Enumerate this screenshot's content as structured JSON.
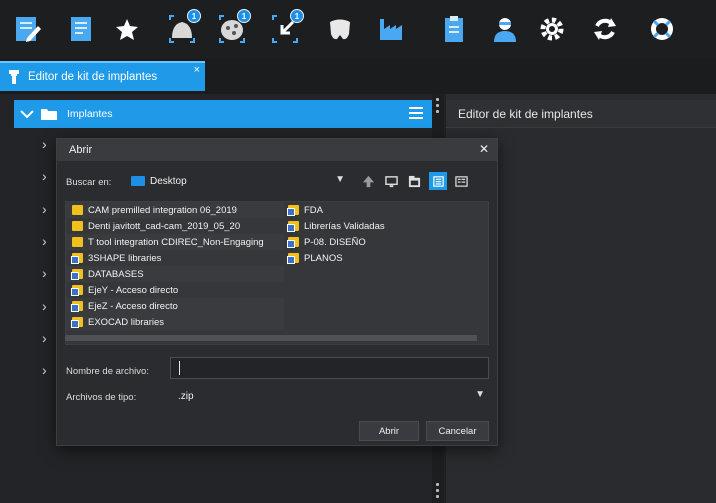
{
  "toolbar": {
    "icons": [
      {
        "name": "edit-document-icon",
        "color": "#4aa8f0"
      },
      {
        "name": "document-icon",
        "color": "#4aa8f0"
      },
      {
        "name": "star-icon",
        "color": "#ffffff"
      },
      {
        "name": "scan-upper-icon",
        "badge": "1"
      },
      {
        "name": "scan-lower-icon",
        "badge": "1"
      },
      {
        "name": "import-icon",
        "badge": "1"
      },
      {
        "name": "jaw-icon"
      },
      {
        "name": "factory-icon"
      },
      {
        "name": "clipboard-icon"
      },
      {
        "name": "user-icon"
      },
      {
        "name": "gear-icon"
      },
      {
        "name": "refresh-icon"
      },
      {
        "name": "lifebuoy-icon"
      }
    ]
  },
  "tab": {
    "label": "Editor de kit de implantes",
    "close": "×"
  },
  "left_panel": {
    "title": "Implantes",
    "arrow": "›"
  },
  "right_panel": {
    "title": "Editor de kit de implantes"
  },
  "dialog": {
    "title": "Abrir",
    "close": "✕",
    "look_in_label": "Buscar en:",
    "look_in_value": "Desktop",
    "files_col1": [
      {
        "label": "CAM premilled integration 06_2019",
        "type": "folder"
      },
      {
        "label": "Denti javitott_cad-cam_2019_05_20",
        "type": "folder"
      },
      {
        "label": "T tool integration CDIREC_Non-Engaging",
        "type": "folder"
      },
      {
        "label": "3SHAPE libraries",
        "type": "shortcut"
      },
      {
        "label": "DATABASES",
        "type": "shortcut"
      },
      {
        "label": "EjeY - Acceso directo",
        "type": "shortcut"
      },
      {
        "label": "EjeZ - Acceso directo",
        "type": "shortcut"
      },
      {
        "label": "EXOCAD libraries",
        "type": "shortcut"
      }
    ],
    "files_col2": [
      {
        "label": "FDA",
        "type": "shortcut"
      },
      {
        "label": "Librerías Validadas",
        "type": "shortcut"
      },
      {
        "label": "P-08. DISEÑO",
        "type": "shortcut"
      },
      {
        "label": "PLANOS",
        "type": "shortcut"
      }
    ],
    "filename_label": "Nombre de archivo:",
    "filename_value": "",
    "filetype_label": "Archivos de tipo:",
    "filetype_value": ".zip",
    "open_button": "Abrir",
    "cancel_button": "Cancelar"
  },
  "colors": {
    "accent": "#1e9ae8",
    "folder": "#f2c01c"
  }
}
